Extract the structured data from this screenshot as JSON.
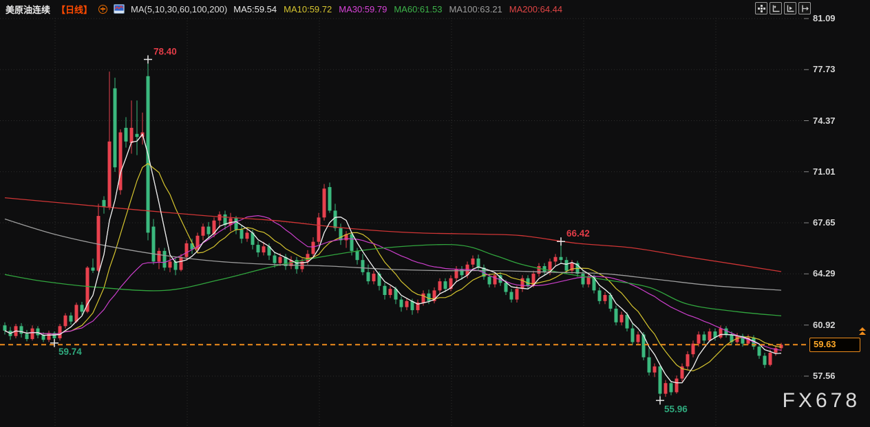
{
  "header": {
    "symbol": "美原油连续",
    "period": "【日线】",
    "ma_group_label": "MA(5,10,30,60,100,200)",
    "ma_values": [
      {
        "label": "MA5:59.54",
        "color": "#e9e9e9"
      },
      {
        "label": "MA10:59.72",
        "color": "#d6c52f"
      },
      {
        "label": "MA30:59.79",
        "color": "#d843d8"
      },
      {
        "label": "MA60:61.53",
        "color": "#3db44a"
      },
      {
        "label": "MA100:63.21",
        "color": "#9d9d9d"
      },
      {
        "label": "MA200:64.44",
        "color": "#e04545"
      }
    ],
    "toolbar_buttons": [
      "move-tool",
      "axis-scale-left",
      "play-forward",
      "pan-right"
    ]
  },
  "axis": {
    "ticks": [
      {
        "label": "81.09",
        "price": 81.09
      },
      {
        "label": "77.73",
        "price": 77.73
      },
      {
        "label": "74.37",
        "price": 74.37
      },
      {
        "label": "71.01",
        "price": 71.01
      },
      {
        "label": "67.65",
        "price": 67.65
      },
      {
        "label": "64.29",
        "price": 64.29
      },
      {
        "label": "60.92",
        "price": 60.92
      },
      {
        "label": "57.56",
        "price": 57.56
      }
    ]
  },
  "price_line": {
    "value": "59.63",
    "price": 59.63,
    "color": "#ef8c1c"
  },
  "markers": [
    {
      "type": "high",
      "label": "78.40",
      "index": 26,
      "price": 78.4,
      "color": "#e23c47"
    },
    {
      "type": "low",
      "label": "59.74",
      "index": 9,
      "price": 59.74,
      "color": "#2fa97d"
    },
    {
      "type": "high",
      "label": "66.42",
      "index": 101,
      "price": 66.42,
      "color": "#e23c47"
    },
    {
      "type": "low",
      "label": "55.96",
      "index": 119,
      "price": 55.96,
      "color": "#2fa97d"
    }
  ],
  "watermark": "FX678",
  "chart_data": {
    "type": "candlestick",
    "title": "美原油连续 日线",
    "legend": [
      "MA5",
      "MA10",
      "MA30",
      "MA60",
      "MA100",
      "MA200"
    ],
    "ylim": [
      54.2,
      82.3
    ],
    "grid": true,
    "up_color": "#e8414e",
    "down_color": "#3bb97e",
    "candles": [
      [
        60.9,
        61.1,
        60.3,
        60.55
      ],
      [
        60.55,
        60.8,
        59.95,
        60.2
      ],
      [
        60.2,
        61.0,
        60.05,
        60.85
      ],
      [
        60.85,
        61.05,
        60.1,
        60.35
      ],
      [
        60.35,
        60.6,
        59.85,
        60.0
      ],
      [
        60.0,
        60.9,
        59.9,
        60.7
      ],
      [
        60.7,
        60.85,
        60.05,
        60.25
      ],
      [
        60.25,
        60.45,
        59.8,
        59.95
      ],
      [
        59.95,
        60.55,
        59.8,
        60.4
      ],
      [
        60.4,
        60.5,
        59.74,
        60.05
      ],
      [
        60.05,
        61.0,
        59.9,
        60.85
      ],
      [
        60.85,
        61.7,
        60.7,
        61.55
      ],
      [
        61.55,
        61.75,
        60.95,
        61.15
      ],
      [
        61.15,
        62.4,
        61.05,
        62.25
      ],
      [
        62.25,
        62.45,
        61.6,
        61.8
      ],
      [
        61.8,
        64.8,
        61.7,
        64.7
      ],
      [
        64.7,
        65.3,
        64.35,
        64.5
      ],
      [
        64.5,
        68.9,
        64.4,
        68.1
      ],
      [
        69.15,
        69.4,
        68.25,
        68.7
      ],
      [
        68.7,
        77.6,
        68.5,
        73.0
      ],
      [
        76.5,
        77.2,
        71.0,
        71.3
      ],
      [
        69.8,
        73.8,
        69.5,
        73.6
      ],
      [
        73.9,
        74.6,
        72.6,
        73.0
      ],
      [
        72.9,
        75.7,
        72.2,
        73.9
      ],
      [
        73.5,
        75.7,
        72.1,
        73.3
      ],
      [
        73.3,
        74.9,
        72.8,
        73.6
      ],
      [
        77.3,
        78.4,
        66.5,
        67.0
      ],
      [
        67.4,
        67.9,
        64.9,
        65.1
      ],
      [
        65.1,
        66.0,
        64.6,
        65.8
      ],
      [
        65.8,
        66.0,
        64.5,
        64.7
      ],
      [
        64.7,
        65.4,
        64.4,
        65.1
      ],
      [
        65.1,
        65.3,
        64.2,
        64.55
      ],
      [
        64.55,
        65.6,
        64.45,
        65.4
      ],
      [
        65.4,
        66.5,
        65.2,
        66.3
      ],
      [
        66.3,
        66.6,
        65.6,
        65.9
      ],
      [
        65.9,
        67.0,
        65.7,
        66.8
      ],
      [
        66.8,
        67.6,
        66.5,
        67.4
      ],
      [
        67.4,
        67.7,
        66.6,
        66.9
      ],
      [
        66.9,
        68.0,
        66.7,
        67.8
      ],
      [
        67.8,
        68.4,
        67.3,
        68.2
      ],
      [
        68.2,
        68.45,
        67.2,
        67.5
      ],
      [
        67.5,
        68.3,
        67.1,
        67.95
      ],
      [
        67.95,
        68.1,
        66.9,
        67.2
      ],
      [
        67.2,
        67.45,
        66.3,
        66.6
      ],
      [
        66.6,
        67.3,
        66.4,
        67.0
      ],
      [
        67.0,
        67.2,
        65.9,
        66.2
      ],
      [
        66.2,
        66.45,
        65.4,
        65.7
      ],
      [
        65.7,
        66.4,
        65.5,
        66.1
      ],
      [
        66.1,
        66.3,
        65.2,
        65.5
      ],
      [
        65.5,
        65.7,
        64.7,
        65.0
      ],
      [
        65.0,
        65.65,
        64.8,
        65.4
      ],
      [
        65.4,
        65.6,
        64.55,
        64.8
      ],
      [
        64.8,
        65.45,
        64.6,
        65.2
      ],
      [
        65.2,
        65.4,
        64.3,
        64.6
      ],
      [
        64.6,
        65.3,
        64.4,
        65.1
      ],
      [
        65.1,
        65.85,
        64.9,
        65.6
      ],
      [
        65.6,
        66.7,
        65.4,
        66.4
      ],
      [
        66.4,
        68.3,
        66.2,
        68.0
      ],
      [
        68.0,
        70.2,
        67.8,
        69.9
      ],
      [
        70.0,
        70.3,
        68.3,
        68.45
      ],
      [
        68.45,
        68.9,
        67.1,
        67.3
      ],
      [
        67.3,
        67.6,
        66.2,
        66.5
      ],
      [
        66.5,
        67.1,
        66.0,
        66.9
      ],
      [
        66.9,
        67.0,
        65.5,
        65.8
      ],
      [
        65.8,
        66.0,
        64.9,
        65.2
      ],
      [
        65.2,
        65.6,
        64.2,
        64.4
      ],
      [
        64.4,
        64.9,
        63.6,
        63.8
      ],
      [
        63.8,
        64.5,
        63.6,
        64.3
      ],
      [
        64.3,
        64.45,
        63.2,
        63.5
      ],
      [
        63.5,
        63.7,
        62.6,
        62.9
      ],
      [
        62.9,
        63.5,
        62.7,
        63.3
      ],
      [
        63.3,
        63.45,
        62.3,
        62.6
      ],
      [
        62.6,
        62.8,
        61.8,
        62.1
      ],
      [
        62.1,
        62.7,
        61.9,
        62.5
      ],
      [
        62.5,
        62.65,
        61.6,
        61.9
      ],
      [
        61.9,
        62.6,
        61.7,
        62.4
      ],
      [
        62.4,
        63.2,
        62.2,
        63.0
      ],
      [
        63.0,
        63.25,
        62.3,
        62.5
      ],
      [
        62.5,
        63.4,
        62.35,
        63.2
      ],
      [
        63.2,
        64.0,
        63.0,
        63.8
      ],
      [
        63.8,
        64.0,
        63.1,
        63.3
      ],
      [
        63.3,
        64.2,
        63.15,
        64.0
      ],
      [
        64.0,
        64.8,
        63.8,
        64.6
      ],
      [
        64.6,
        64.8,
        63.9,
        64.2
      ],
      [
        64.2,
        65.1,
        64.0,
        64.9
      ],
      [
        64.9,
        65.5,
        64.7,
        65.3
      ],
      [
        65.3,
        65.55,
        64.5,
        64.7
      ],
      [
        64.7,
        64.9,
        63.9,
        64.1
      ],
      [
        64.1,
        64.3,
        63.4,
        63.6
      ],
      [
        63.6,
        64.4,
        63.4,
        64.2
      ],
      [
        64.2,
        64.4,
        63.5,
        63.7
      ],
      [
        63.7,
        63.9,
        62.9,
        63.1
      ],
      [
        63.1,
        63.3,
        62.4,
        62.6
      ],
      [
        62.6,
        63.5,
        62.4,
        63.3
      ],
      [
        63.3,
        64.2,
        63.1,
        64.0
      ],
      [
        64.0,
        64.2,
        63.3,
        63.5
      ],
      [
        63.5,
        64.5,
        63.4,
        64.3
      ],
      [
        64.3,
        65.0,
        64.1,
        64.8
      ],
      [
        64.8,
        65.0,
        64.2,
        64.4
      ],
      [
        64.4,
        65.3,
        64.2,
        65.1
      ],
      [
        65.1,
        65.6,
        64.8,
        65.4
      ],
      [
        65.4,
        66.42,
        65.0,
        65.2
      ],
      [
        65.2,
        65.4,
        64.3,
        64.5
      ],
      [
        64.5,
        65.2,
        64.3,
        65.0
      ],
      [
        65.0,
        65.15,
        64.1,
        64.3
      ],
      [
        64.3,
        64.5,
        63.4,
        63.6
      ],
      [
        63.6,
        64.3,
        63.4,
        64.1
      ],
      [
        64.1,
        64.25,
        63.0,
        63.2
      ],
      [
        63.2,
        63.4,
        62.3,
        62.5
      ],
      [
        62.5,
        63.1,
        62.3,
        62.9
      ],
      [
        62.9,
        63.05,
        61.8,
        62.0
      ],
      [
        62.0,
        62.2,
        60.9,
        61.1
      ],
      [
        61.1,
        61.8,
        60.9,
        61.6
      ],
      [
        61.6,
        61.75,
        60.5,
        60.7
      ],
      [
        60.7,
        61.0,
        59.6,
        59.8
      ],
      [
        59.8,
        60.5,
        59.6,
        60.3
      ],
      [
        60.3,
        60.45,
        58.6,
        58.8
      ],
      [
        58.8,
        59.4,
        57.6,
        57.8
      ],
      [
        57.8,
        58.4,
        57.5,
        58.2
      ],
      [
        58.2,
        58.35,
        55.96,
        56.4
      ],
      [
        56.4,
        57.3,
        56.2,
        57.1
      ],
      [
        57.1,
        57.25,
        56.3,
        56.5
      ],
      [
        56.5,
        57.6,
        56.4,
        57.4
      ],
      [
        57.4,
        58.4,
        57.2,
        58.2
      ],
      [
        58.2,
        59.2,
        58.0,
        59.0
      ],
      [
        59.0,
        59.9,
        58.8,
        59.7
      ],
      [
        59.7,
        60.5,
        59.5,
        60.3
      ],
      [
        60.3,
        60.5,
        59.7,
        59.9
      ],
      [
        59.9,
        60.7,
        59.8,
        60.5
      ],
      [
        60.5,
        60.7,
        59.9,
        60.1
      ],
      [
        60.1,
        60.9,
        60.0,
        60.7
      ],
      [
        60.7,
        60.85,
        60.1,
        60.3
      ],
      [
        60.3,
        60.5,
        59.6,
        59.8
      ],
      [
        59.8,
        60.4,
        59.7,
        60.2
      ],
      [
        60.2,
        60.35,
        59.5,
        59.7
      ],
      [
        59.7,
        60.3,
        59.6,
        60.1
      ],
      [
        60.1,
        60.25,
        59.3,
        59.5
      ],
      [
        59.5,
        59.7,
        58.7,
        58.9
      ],
      [
        58.9,
        59.1,
        58.1,
        58.3
      ],
      [
        58.3,
        59.3,
        58.2,
        59.1
      ],
      [
        59.1,
        59.6,
        58.9,
        59.4
      ],
      [
        59.4,
        59.75,
        59.2,
        59.63
      ]
    ],
    "ma_computed": [
      {
        "name": "MA5",
        "window": 5,
        "color": "#ededed"
      },
      {
        "name": "MA10",
        "window": 10,
        "color": "#d6c52f"
      },
      {
        "name": "MA30",
        "window": 30,
        "color": "#cc3fcc"
      }
    ],
    "ma_overlay": [
      {
        "name": "MA60",
        "color": "#31a53e",
        "points": [
          [
            0,
            64.25
          ],
          [
            7,
            63.8
          ],
          [
            17,
            63.4
          ],
          [
            29,
            63.2
          ],
          [
            39,
            63.9
          ],
          [
            49,
            64.8
          ],
          [
            59,
            65.5
          ],
          [
            69,
            66.0
          ],
          [
            82,
            66.2
          ],
          [
            89,
            65.5
          ],
          [
            94,
            64.9
          ],
          [
            102,
            64.3
          ],
          [
            109,
            63.9
          ],
          [
            117,
            63.4
          ],
          [
            124,
            62.3
          ],
          [
            133,
            61.8
          ],
          [
            141,
            61.53
          ]
        ]
      },
      {
        "name": "MA100",
        "color": "#9d9d9d",
        "points": [
          [
            0,
            67.9
          ],
          [
            9,
            66.9
          ],
          [
            19,
            66.1
          ],
          [
            29,
            65.5
          ],
          [
            39,
            65.1
          ],
          [
            49,
            64.9
          ],
          [
            59,
            64.8
          ],
          [
            69,
            64.6
          ],
          [
            79,
            64.5
          ],
          [
            89,
            64.5
          ],
          [
            99,
            64.4
          ],
          [
            109,
            64.3
          ],
          [
            119,
            63.9
          ],
          [
            129,
            63.5
          ],
          [
            141,
            63.21
          ]
        ]
      },
      {
        "name": "MA200",
        "color": "#cf3535",
        "points": [
          [
            0,
            69.3
          ],
          [
            12,
            68.9
          ],
          [
            24,
            68.5
          ],
          [
            37,
            68.1
          ],
          [
            49,
            67.8
          ],
          [
            62,
            67.3
          ],
          [
            74,
            67.0
          ],
          [
            87,
            66.9
          ],
          [
            94,
            66.8
          ],
          [
            104,
            66.3
          ],
          [
            114,
            66.0
          ],
          [
            124,
            65.4
          ],
          [
            133,
            64.9
          ],
          [
            141,
            64.44
          ]
        ]
      }
    ]
  }
}
